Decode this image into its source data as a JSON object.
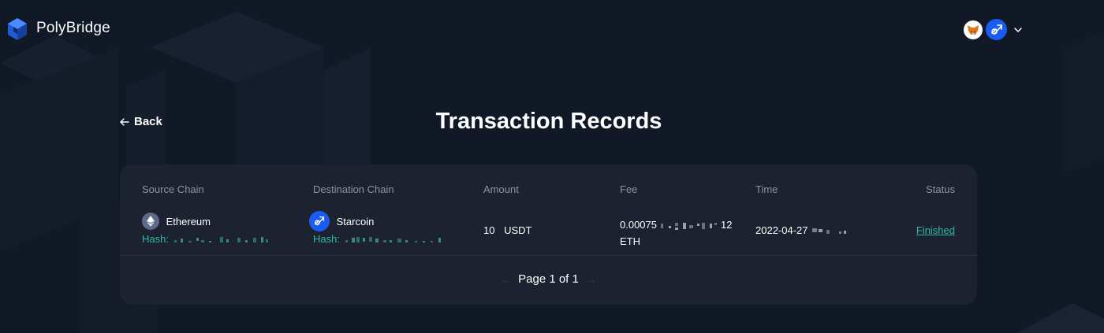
{
  "header": {
    "brand": "PolyBridge",
    "wallet_icons": [
      "metamask-fox-icon",
      "starcoin-icon"
    ]
  },
  "page": {
    "back_label": "Back",
    "title": "Transaction Records"
  },
  "table": {
    "columns": [
      "Source Chain",
      "Destination Chain",
      "Amount",
      "Fee",
      "Time",
      "Status"
    ],
    "rows": [
      {
        "source_chain": "Ethereum",
        "source_hash_label": "Hash:",
        "destination_chain": "Starcoin",
        "destination_hash_label": "Hash:",
        "amount": "10",
        "amount_token": "USDT",
        "fee_prefix": "0.00075",
        "fee_suffix": "12",
        "fee_token": "ETH",
        "time": "2022-04-27",
        "status": "Finished"
      }
    ]
  },
  "pagination": {
    "label": "Page 1 of 1",
    "prev": "←",
    "next": "→"
  },
  "colors": {
    "background": "#111826",
    "card": "#1c2230",
    "accent_teal": "#2fb8a5",
    "starcoin_blue": "#1a5cf2",
    "muted_text": "#8c93a3"
  }
}
